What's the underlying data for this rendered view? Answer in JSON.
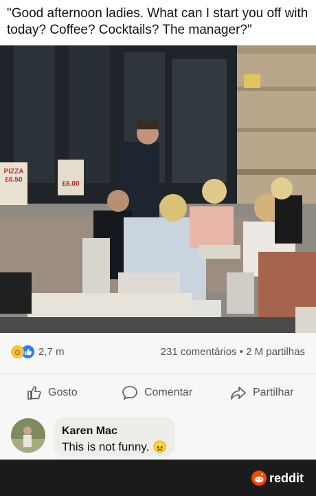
{
  "post": {
    "caption": "\"Good afternoon ladies. What can I start you off with today? Coffee? Cocktails? The manager?\"",
    "sign_left": "PIZZA £6.50",
    "sign_right": "£6.00"
  },
  "stats": {
    "reaction_icons": [
      "haha-icon",
      "like-icon"
    ],
    "reaction_count": "2,7 m",
    "comments_shares": "231 comentários • 2 M partilhas"
  },
  "actions": {
    "like": "Gosto",
    "comment": "Comentar",
    "share": "Partilhar"
  },
  "comment": {
    "author": "Karen Mac",
    "text": "This is not funny.",
    "emoji": "😠"
  },
  "footer": {
    "brand": "reddit"
  },
  "colors": {
    "like_blue": "#2e7cf6",
    "haha_yellow": "#f5c33b",
    "reddit_orange": "#ff4500",
    "footer_bg": "#1b1b1b"
  }
}
